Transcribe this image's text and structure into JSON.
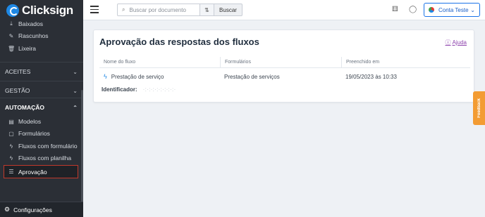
{
  "brand": {
    "name": "Clicksign"
  },
  "sidebar": {
    "items_top": [
      {
        "label": "Baixados",
        "icon": "download-icon"
      },
      {
        "label": "Rascunhos",
        "icon": "draft-icon"
      },
      {
        "label": "Lixeira",
        "icon": "trash-icon"
      }
    ],
    "sections": [
      {
        "label": "ACEITES"
      },
      {
        "label": "GESTÃO"
      },
      {
        "label": "AUTOMAÇÃO"
      }
    ],
    "automation_items": [
      {
        "label": "Modelos",
        "icon": "template-icon"
      },
      {
        "label": "Formulários",
        "icon": "form-icon"
      },
      {
        "label": "Fluxos com formulário",
        "icon": "lightning-icon"
      },
      {
        "label": "Fluxos com planilha",
        "icon": "lightning-icon"
      },
      {
        "label": "Aprovação",
        "icon": "checklist-icon"
      }
    ],
    "settings_label": "Configurações"
  },
  "topbar": {
    "search_placeholder": "Buscar por documento",
    "search_button": "Buscar",
    "account_label": "Conta Teste"
  },
  "main": {
    "title": "Aprovação das respostas dos fluxos",
    "help_label": "Ajuda",
    "columns": [
      "Nome do fluxo",
      "Formulários",
      "Preenchido em"
    ],
    "row": {
      "flow_name": "Prestação de serviço",
      "form": "Prestação de serviços",
      "filled_at": "19/05/2023 às 10:33"
    },
    "identifier_label": "Identificador:",
    "identifier_value": "·:·:·:·:·:·:·:·:·"
  },
  "feedback_label": "Feedback"
}
